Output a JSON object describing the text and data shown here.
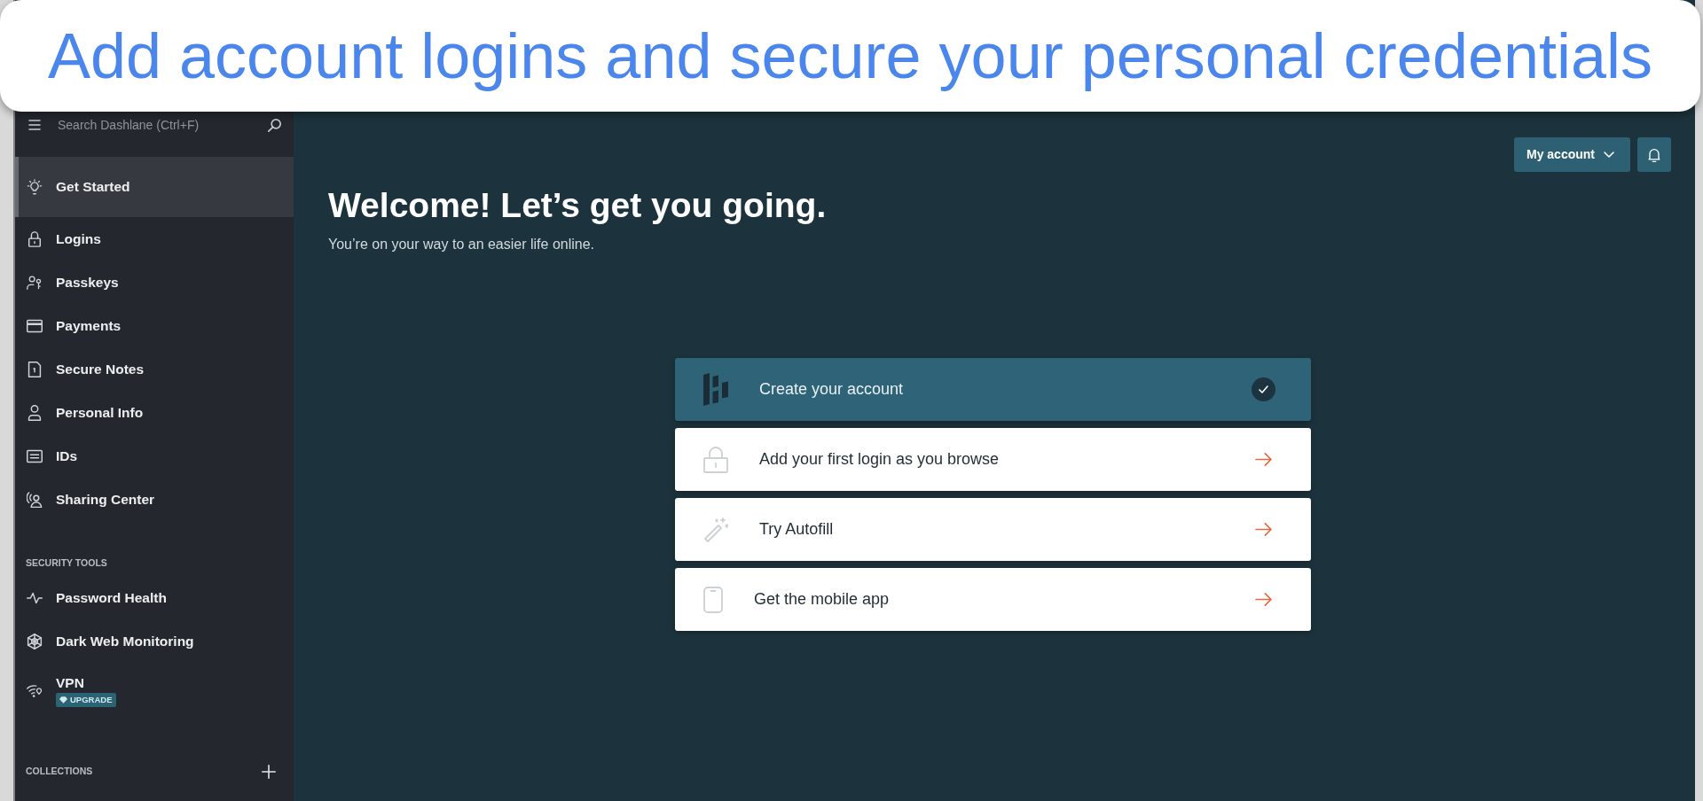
{
  "caption": "Add account logins and secure your personal credentials",
  "sidebar": {
    "search": {
      "placeholder": "Search Dashlane (Ctrl+F)"
    },
    "items": [
      {
        "label": "Get Started",
        "selected": true
      },
      {
        "label": "Logins",
        "selected": false
      },
      {
        "label": "Passkeys",
        "selected": false
      },
      {
        "label": "Payments",
        "selected": false
      },
      {
        "label": "Secure Notes",
        "selected": false
      },
      {
        "label": "Personal Info",
        "selected": false
      },
      {
        "label": "IDs",
        "selected": false
      },
      {
        "label": "Sharing Center",
        "selected": false
      }
    ],
    "security_tools": {
      "heading": "SECURITY TOOLS",
      "items": [
        {
          "label": "Password Health",
          "selected": false
        },
        {
          "label": "Dark Web Monitoring",
          "selected": false
        },
        {
          "label": "VPN",
          "selected": false,
          "badge": "UPGRADE"
        }
      ]
    },
    "collections": {
      "heading": "COLLECTIONS"
    }
  },
  "header": {
    "account_button": "My account"
  },
  "main": {
    "title": "Welcome! Let’s get you going.",
    "subtitle": "You’re on your way to an easier life online.",
    "steps": [
      {
        "label": "Create your account",
        "done": true
      },
      {
        "label": "Add your first login as you browse",
        "done": false
      },
      {
        "label": "Try Autofill",
        "done": false
      },
      {
        "label": "Get the mobile app",
        "done": false
      }
    ]
  }
}
